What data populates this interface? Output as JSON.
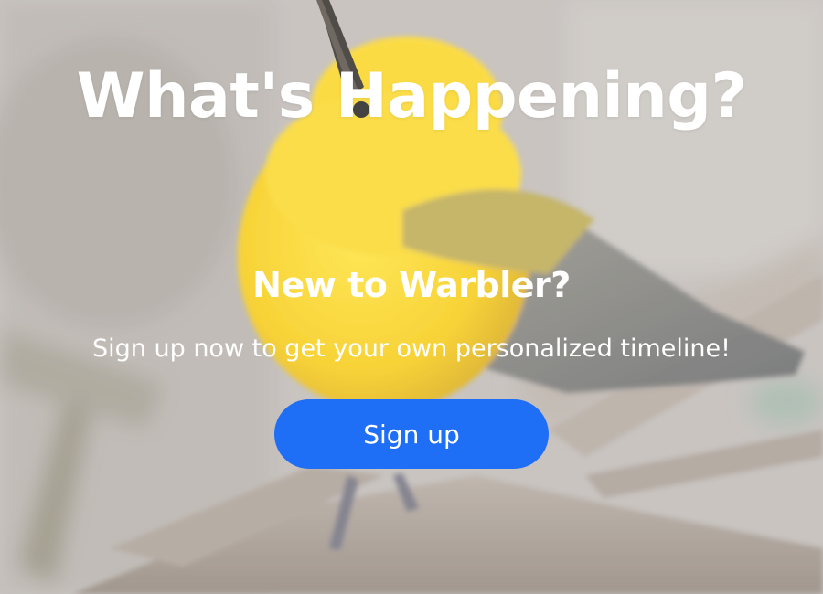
{
  "hero": {
    "headline": "What's Happening?",
    "subhead": "New to Warbler?",
    "tagline": "Sign up now to get your own personalized timeline!",
    "signup_label": "Sign up",
    "background_image": "yellow-warbler-on-branch",
    "accent_color": "#1f6ef6"
  }
}
